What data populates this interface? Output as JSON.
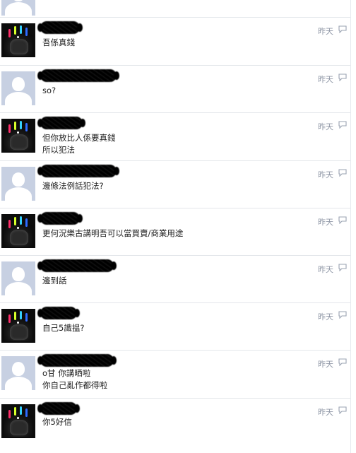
{
  "messages": [
    {
      "avatar": "photo-neon-hand",
      "text_lines": [
        "吾係真錢"
      ],
      "time": "昨天",
      "name_width": 56
    },
    {
      "avatar": "default-silhouette",
      "text_lines": [
        "so?"
      ],
      "time": "昨天",
      "name_width": 108
    },
    {
      "avatar": "photo-neon-hand",
      "text_lines": [
        "但你放比人係要真錢",
        "所以犯法"
      ],
      "time": "昨天",
      "name_width": 60
    },
    {
      "avatar": "default-silhouette",
      "text_lines": [
        "邊條法例話犯法?"
      ],
      "time": "昨天",
      "name_width": 108
    },
    {
      "avatar": "photo-neon-hand",
      "text_lines": [
        "更何況樂古講明吾可以當買賣/商業用途"
      ],
      "time": "昨天",
      "name_width": 56
    },
    {
      "avatar": "default-silhouette",
      "text_lines": [
        "邊到話"
      ],
      "time": "昨天",
      "name_width": 104
    },
    {
      "avatar": "photo-neon-hand",
      "text_lines": [
        "自己5識揾?"
      ],
      "time": "昨天",
      "name_width": 52
    },
    {
      "avatar": "default-silhouette",
      "text_lines": [
        "o甘 你講晒啦",
        "你自己亂作都得啦"
      ],
      "time": "昨天",
      "name_width": 104
    },
    {
      "avatar": "photo-neon-hand",
      "text_lines": [
        "你5好信"
      ],
      "time": "昨天",
      "name_width": 52
    }
  ],
  "colors": {
    "timestamp": "#8f97a6",
    "divider": "#e3e6ea",
    "default_avatar_bg": "#c7d0e2"
  },
  "icons": {
    "reply": "reply-icon",
    "default_avatar": "default-avatar-icon"
  }
}
